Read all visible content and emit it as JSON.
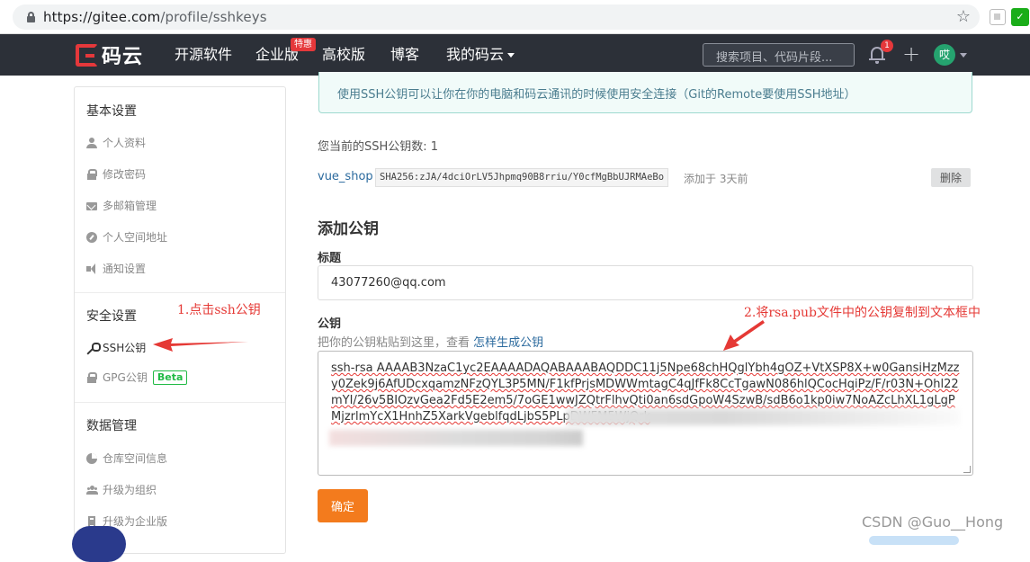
{
  "browser": {
    "url_host": "https://gitee.com",
    "url_path": "/profile/sshkeys"
  },
  "nav": {
    "logo_text": "码云",
    "links": [
      "开源软件",
      "企业版",
      "高校版",
      "博客",
      "我的码云"
    ],
    "hot_badge": "特惠",
    "search_placeholder": "搜索项目、代码片段...",
    "notification_count": "1",
    "avatar_text": "哎"
  },
  "sidebar": {
    "basic": {
      "title": "基本设置",
      "items": [
        "个人资料",
        "修改密码",
        "多邮箱管理",
        "个人空间地址",
        "通知设置"
      ]
    },
    "security": {
      "title": "安全设置",
      "items": [
        "SSH公钥",
        "GPG公钥"
      ],
      "beta": "Beta"
    },
    "data": {
      "title": "数据管理",
      "items": [
        "仓库空间信息",
        "升级为组织",
        "升级为企业版"
      ]
    }
  },
  "annotations": {
    "step1": "1.点击ssh公钥",
    "step2": "2.将rsa.pub文件中的公钥复制到文本框中",
    "color": "#e53935"
  },
  "main": {
    "info": "使用SSH公钥可以让你在你的电脑和码云通讯的时候使用安全连接（Git的Remote要使用SSH地址）",
    "count_text": "您当前的SSH公钥数: 1",
    "key": {
      "name": "vue_shop",
      "fingerprint": "SHA256:zJA/4dciOrLV5Jhpmq90B8rriu/Y0cfMgBbUJRMAeBo",
      "added": "添加于 3天前",
      "delete_label": "删除"
    },
    "add_heading": "添加公钥",
    "title_label": "标题",
    "title_value": "43077260@qq.com",
    "key_label": "公钥",
    "hint_prefix": "把你的公钥粘贴到这里，查看",
    "hint_link": "怎样生成公钥",
    "key_value": "ssh-rsa AAAAB3NzaC1yc2EAAAADAQABAAABAQDDC11j5Npe68chHQglYbh4gOZ+VtXSP8X+w0GansiHzMzzy0Zek9j6AfUDcxqamzNFzQYL3P5MN/F1kfPrjsMDWWmtagC4qJfFk8CcTgawN086hlQCocHqiPz/F/r03N+Ohl22mYI/26v5BIOzvGea2Fd5E2em5/7oGE1wwJZQtrFlhvQti0an6sdGpoW4SzwB/sdB6o1kp0iw7NoAZcLhXL1gLgPMjzrlmYcX1HnhZ5XarkVgeblfqdLjbS5PLpDWFM5WjQrk",
    "submit_label": "确定"
  },
  "watermark": "CSDN @Guo__Hong",
  "colors": {
    "nav_bg": "#2c3038",
    "accent_red": "#e5383b",
    "submit_orange": "#f37b1d",
    "info_bg": "#f1fbf9",
    "link_blue": "#2b6a9e",
    "beta_green": "#21ba45"
  }
}
